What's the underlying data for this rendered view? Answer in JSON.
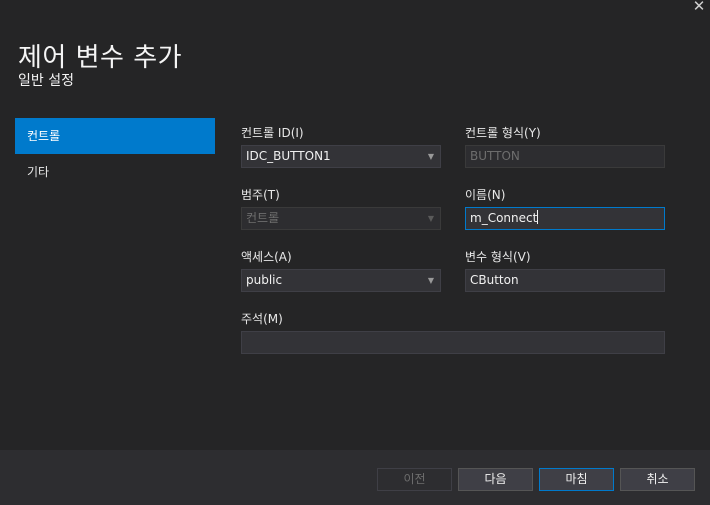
{
  "dialog": {
    "title": "제어 변수 추가",
    "subtitle": "일반 설정",
    "close_glyph": "✕"
  },
  "nav": {
    "items": [
      {
        "label": "컨트롤",
        "active": true
      },
      {
        "label": "기타",
        "active": false
      }
    ]
  },
  "form": {
    "control_id": {
      "label": "컨트롤 ID(I)",
      "value": "IDC_BUTTON1"
    },
    "control_type": {
      "label": "컨트롤 형식(Y)",
      "value": "BUTTON"
    },
    "category": {
      "label": "범주(T)",
      "value": "컨트롤"
    },
    "name": {
      "label": "이름(N)",
      "value": "m_Connect"
    },
    "access": {
      "label": "액세스(A)",
      "value": "public"
    },
    "variable_type": {
      "label": "변수 형식(V)",
      "value": "CButton"
    },
    "comment": {
      "label": "주석(M)",
      "value": ""
    }
  },
  "buttons": {
    "prev": "이전",
    "next": "다음",
    "finish": "마침",
    "cancel": "취소"
  },
  "colors": {
    "background": "#252526",
    "accent": "#007acc",
    "field": "#333337"
  },
  "icons": {
    "close": "close-icon",
    "dropdown": "chevron-down-icon"
  }
}
